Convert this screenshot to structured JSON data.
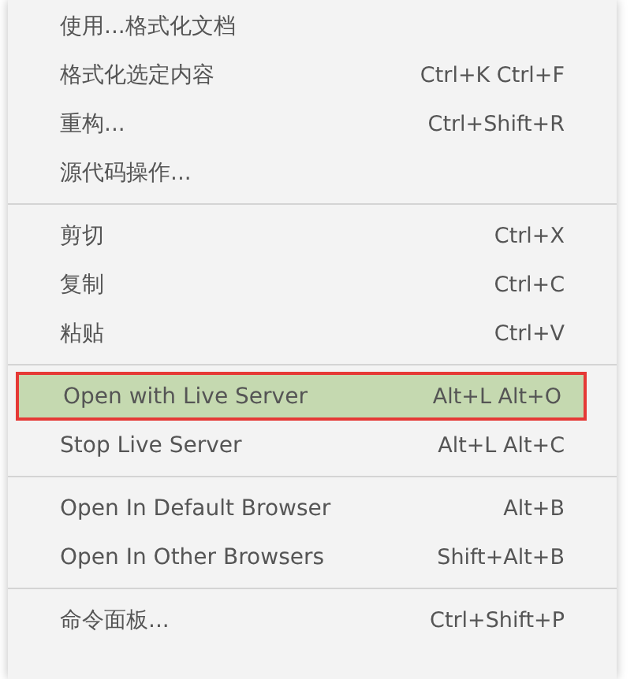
{
  "context_menu": {
    "groups": [
      {
        "items": [
          {
            "label": "使用...格式化文档",
            "selected": false
          },
          {
            "label": "格式化选定内容",
            "shortcut": "Ctrl+K Ctrl+F",
            "selected": false
          },
          {
            "label": "重构...",
            "shortcut": "Ctrl+Shift+R",
            "selected": false
          },
          {
            "label": "源代码操作...",
            "selected": false
          }
        ]
      },
      {
        "items": [
          {
            "label": "剪切",
            "shortcut": "Ctrl+X",
            "selected": false
          },
          {
            "label": "复制",
            "shortcut": "Ctrl+C",
            "selected": false
          },
          {
            "label": "粘贴",
            "shortcut": "Ctrl+V",
            "selected": false
          }
        ]
      },
      {
        "items": [
          {
            "label": "Open with Live Server",
            "shortcut": "Alt+L Alt+O",
            "selected": true
          },
          {
            "label": "Stop Live Server",
            "shortcut": "Alt+L Alt+C",
            "selected": false
          }
        ]
      },
      {
        "items": [
          {
            "label": "Open In Default Browser",
            "shortcut": "Alt+B",
            "selected": false
          },
          {
            "label": "Open In Other Browsers",
            "shortcut": "Shift+Alt+B",
            "selected": false
          }
        ]
      },
      {
        "items": [
          {
            "label": "命令面板...",
            "shortcut": "Ctrl+Shift+P",
            "selected": false
          }
        ]
      }
    ]
  }
}
